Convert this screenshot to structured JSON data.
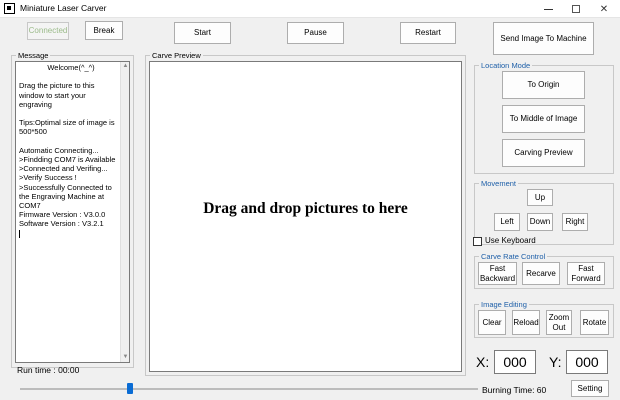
{
  "window": {
    "title": "Miniature Laser Carver",
    "close_glyph": "✕"
  },
  "toolbar": {
    "connected_label": "Connected",
    "break_label": "Break",
    "start_label": "Start",
    "pause_label": "Pause",
    "restart_label": "Restart",
    "send_label": "Send Image To Machine"
  },
  "message": {
    "legend": "Message",
    "lines": [
      "Welcome(^_^)",
      "",
      "Drag the picture to this",
      "window to start your",
      "engraving",
      "",
      "Tips:Optimal size of image is",
      "500*500",
      "",
      "Automatic Connecting...",
      ">Findding COM7 is Available",
      ">Connected and Verifing...",
      ">Verify Success !",
      ">Successfully Connected to",
      "the Engraving Machine at",
      "COM7",
      "Firmware Version : V3.0.0",
      "Software Version : V3.2.1"
    ],
    "scroll_up": "▲",
    "scroll_down": "▼"
  },
  "preview": {
    "legend": "Carve Preview",
    "drop_text": "Drag and drop pictures to here"
  },
  "location_mode": {
    "legend": "Location Mode",
    "to_origin": "To Origin",
    "to_middle": "To Middle of Image",
    "carving_preview": "Carving Preview"
  },
  "movement": {
    "legend": "Movement",
    "up": "Up",
    "left": "Left",
    "down": "Down",
    "right": "Right",
    "use_keyboard": "Use Keyboard"
  },
  "carve_rate": {
    "legend": "Carve Rate Control",
    "fast_backward": "Fast Backward",
    "recarve": "Recarve",
    "fast_forward": "Fast Forward"
  },
  "image_editing": {
    "legend": "Image Editing",
    "clear": "Clear",
    "reload": "Reload",
    "zoom_out": "Zoom Out",
    "rotate": "Rotate"
  },
  "coords": {
    "x_label": "X:",
    "x_value": "000",
    "y_label": "Y:",
    "y_value": "000"
  },
  "status": {
    "run_time": "Run time :  00:00",
    "burning_time": "Burning Time: 60",
    "setting_label": "Setting"
  },
  "burning_slider": {
    "value_fraction": 0.24
  },
  "colors": {
    "accent": "#0a6cd4",
    "group_title": "#1e5fa8",
    "disabled_text": "#9bbb8a"
  }
}
